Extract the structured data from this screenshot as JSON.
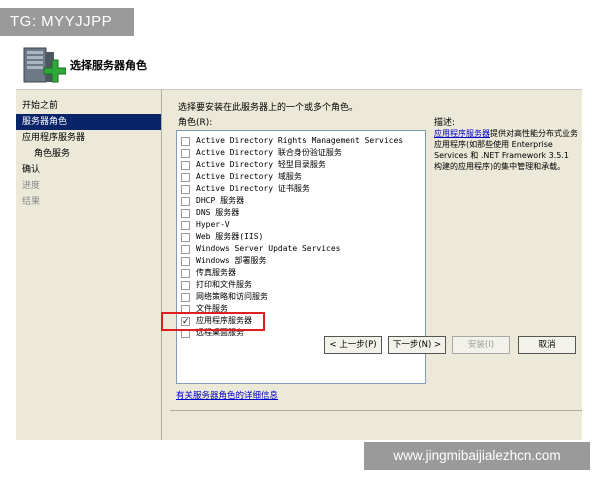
{
  "badge": {
    "text": "TG: MYYJJPP"
  },
  "header": {
    "title": "选择服务器角色"
  },
  "nav": {
    "items": [
      {
        "label": "开始之前",
        "state": "normal",
        "level": 0
      },
      {
        "label": "服务器角色",
        "state": "selected",
        "level": 0
      },
      {
        "label": "应用程序服务器",
        "state": "normal",
        "level": 0
      },
      {
        "label": "角色服务",
        "state": "normal",
        "level": 1
      },
      {
        "label": "确认",
        "state": "normal",
        "level": 0
      },
      {
        "label": "进度",
        "state": "disabled",
        "level": 0
      },
      {
        "label": "结果",
        "state": "disabled",
        "level": 0
      }
    ]
  },
  "main": {
    "prompt": "选择要安装在此服务器上的一个或多个角色。",
    "roles_label": "角色(R):",
    "roles": [
      {
        "label": "Active Directory Rights Management Services",
        "checked": false
      },
      {
        "label": "Active Directory 联合身份验证服务",
        "checked": false
      },
      {
        "label": "Active Directory 轻型目录服务",
        "checked": false
      },
      {
        "label": "Active Directory 域服务",
        "checked": false
      },
      {
        "label": "Active Directory 证书服务",
        "checked": false
      },
      {
        "label": "DHCP 服务器",
        "checked": false
      },
      {
        "label": "DNS 服务器",
        "checked": false
      },
      {
        "label": "Hyper-V",
        "checked": false
      },
      {
        "label": "Web 服务器(IIS)",
        "checked": false
      },
      {
        "label": "Windows Server Update Services",
        "checked": false
      },
      {
        "label": "Windows 部署服务",
        "checked": false
      },
      {
        "label": "传真服务器",
        "checked": false
      },
      {
        "label": "打印和文件服务",
        "checked": false
      },
      {
        "label": "网络策略和访问服务",
        "checked": false
      },
      {
        "label": "文件服务",
        "checked": false
      },
      {
        "label": "应用程序服务器",
        "checked": true
      },
      {
        "label": "远程桌面服务",
        "checked": false
      }
    ],
    "more_link": "有关服务器角色的详细信息",
    "description": {
      "title": "描述:",
      "link": "应用程序服务器",
      "text": "提供对高性能分布式业务应用程序(如那些使用 Enterprise Services 和 .NET Framework 3.5.1 构建的应用程序)的集中管理和承载。"
    }
  },
  "buttons": {
    "prev": "< 上一步(P)",
    "next": "下一步(N) >",
    "install": "安装(I)",
    "cancel": "取消"
  },
  "watermark": {
    "text": "www.jingmibaijialezhcn.com"
  },
  "colors": {
    "selection": "#0a246a",
    "panel": "#ece9d8",
    "link": "#0000cc",
    "highlight": "#e02020"
  }
}
